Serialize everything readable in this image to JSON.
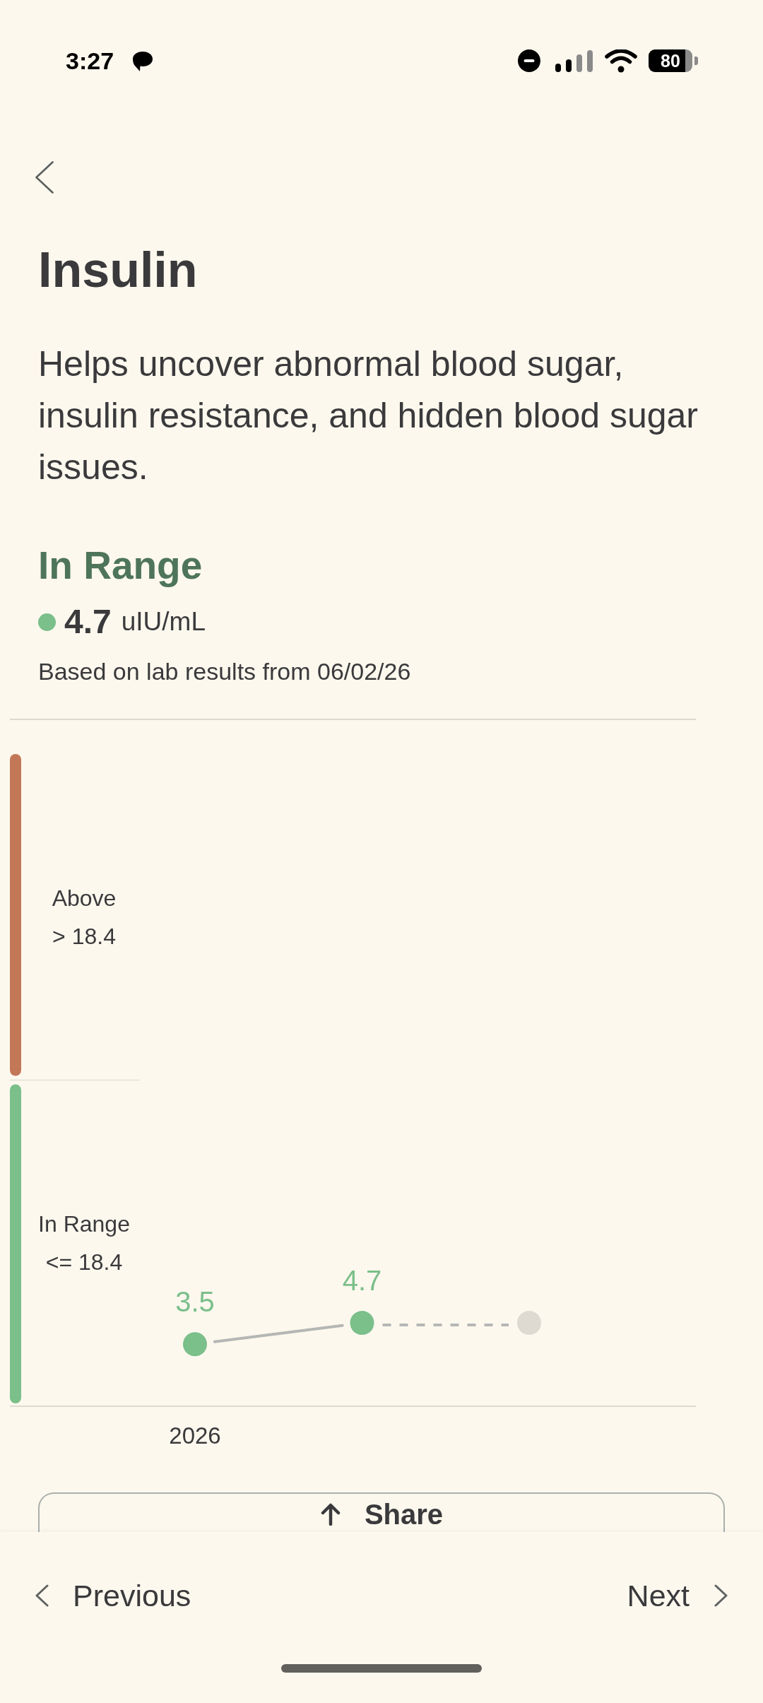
{
  "status_bar": {
    "time": "3:27",
    "battery": "80"
  },
  "title": "Insulin",
  "description": "Helps uncover abnormal blood sugar, insulin resistance, and hidden blood sugar issues.",
  "result": {
    "status": "In Range",
    "value": "4.7",
    "unit": "uIU/mL",
    "note": "Based on lab results from 06/02/26"
  },
  "chart": {
    "bands": [
      {
        "label": "Above",
        "range": "> 18.4",
        "color": "#c27857"
      },
      {
        "label": "In Range",
        "range": "<= 18.4",
        "color": "#7bbf8a"
      }
    ],
    "points": [
      {
        "label": "3.5"
      },
      {
        "label": "4.7"
      }
    ],
    "pending_next": true,
    "period_label": "2026"
  },
  "share_button": {
    "label": "Share"
  },
  "navigation": {
    "previous": "Previous",
    "next": "Next"
  }
}
